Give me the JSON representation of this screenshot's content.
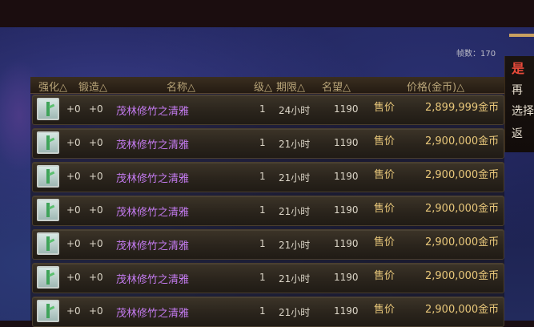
{
  "fps": {
    "label": "帧数：170"
  },
  "side_menu": {
    "items": [
      "是",
      "再",
      "选择",
      "返"
    ]
  },
  "table": {
    "headers": {
      "enhance": "强化△",
      "forge": "锻造△",
      "name": "名称△",
      "level": "级△",
      "duration": "期限△",
      "fame": "名望△",
      "price": "价格(金币)△"
    },
    "rows": [
      {
        "enhance": "+0",
        "forge": "+0",
        "name": "茂林修竹之清雅",
        "level": "1",
        "duration": "24小时",
        "fame": "1190",
        "sell": "售价",
        "price": "2,899,999金币"
      },
      {
        "enhance": "+0",
        "forge": "+0",
        "name": "茂林修竹之清雅",
        "level": "1",
        "duration": "21小时",
        "fame": "1190",
        "sell": "售价",
        "price": "2,900,000金币"
      },
      {
        "enhance": "+0",
        "forge": "+0",
        "name": "茂林修竹之清雅",
        "level": "1",
        "duration": "21小时",
        "fame": "1190",
        "sell": "售价",
        "price": "2,900,000金币"
      },
      {
        "enhance": "+0",
        "forge": "+0",
        "name": "茂林修竹之清雅",
        "level": "1",
        "duration": "21小时",
        "fame": "1190",
        "sell": "售价",
        "price": "2,900,000金币"
      },
      {
        "enhance": "+0",
        "forge": "+0",
        "name": "茂林修竹之清雅",
        "level": "1",
        "duration": "21小时",
        "fame": "1190",
        "sell": "售价",
        "price": "2,900,000金币"
      },
      {
        "enhance": "+0",
        "forge": "+0",
        "name": "茂林修竹之清雅",
        "level": "1",
        "duration": "21小时",
        "fame": "1190",
        "sell": "售价",
        "price": "2,900,000金币"
      },
      {
        "enhance": "+0",
        "forge": "+0",
        "name": "茂林修竹之清雅",
        "level": "1",
        "duration": "21小时",
        "fame": "1190",
        "sell": "售价",
        "price": "2,900,000金币"
      }
    ]
  },
  "colors": {
    "item_name": "#c47bf0",
    "gold_text": "#e8c77a",
    "header_text": "#b8a478"
  },
  "icons": {
    "item_icon": "bamboo-item-icon"
  }
}
